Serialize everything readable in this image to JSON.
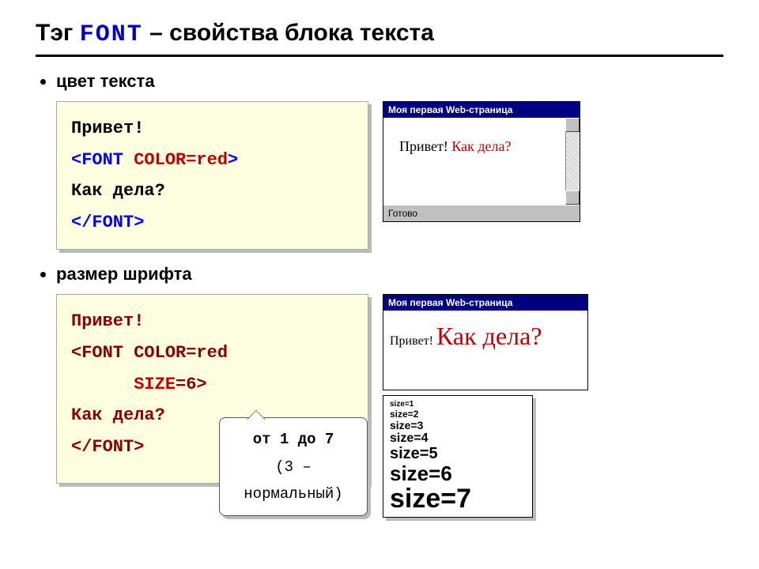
{
  "heading": {
    "tag": "Тэг",
    "keyword": "FONT",
    "rest": "– свойства блока текста"
  },
  "items": {
    "color": {
      "label": "цвет текста",
      "code": {
        "l1": "Привет!",
        "l2a": "<FONT ",
        "l2b": "COLOR=red",
        "l2c": ">",
        "l3": "Как дела?",
        "l4": "</FONT>"
      },
      "preview": {
        "title": "Моя первая Web-страница",
        "text1": "Привет! ",
        "text2": "Как дела?",
        "status": "Готово"
      }
    },
    "size": {
      "label": "размер шрифта",
      "code": {
        "l1": "Привет!",
        "l2": "<FONT COLOR=red",
        "l3a": "SIZE",
        "l3b": "=6>",
        "l4": "Как дела?",
        "l5": "</FONT>"
      },
      "preview": {
        "title": "Моя первая Web-страница",
        "text1": "Привет! ",
        "text2": "Как дела?"
      },
      "sizes": {
        "s1": "size=1",
        "s2": "size=2",
        "s3": "size=3",
        "s4": "size=4",
        "s5": "size=5",
        "s6": "size=6",
        "s7": "size=7"
      },
      "callout": {
        "l1": "от 1 до 7",
        "l2": "(3 – нормальный)"
      }
    }
  }
}
